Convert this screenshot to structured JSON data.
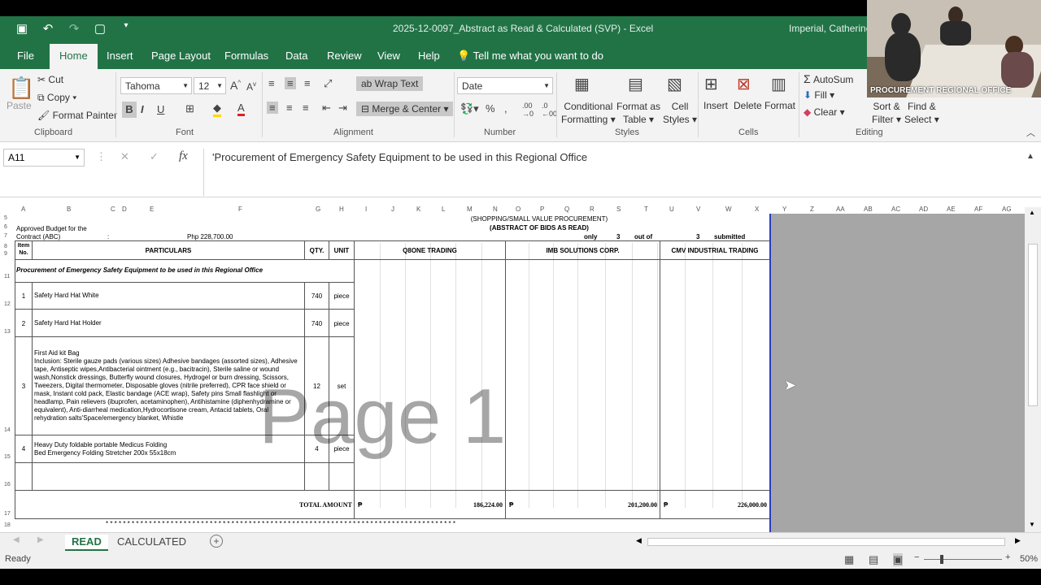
{
  "window": {
    "doc_title": "2025-12-0097_Abstract as Read & Calculated (SVP)  -  Excel",
    "user_name": "Imperial, Catherine"
  },
  "menu": {
    "tabs": [
      "File",
      "Home",
      "Insert",
      "Page Layout",
      "Formulas",
      "Data",
      "Review",
      "View",
      "Help"
    ],
    "tell_me": "Tell me what you want to do"
  },
  "ribbon": {
    "clipboard": {
      "paste": "Paste",
      "cut": "Cut",
      "copy": "Copy",
      "format_painter": "Format Painter",
      "label": "Clipboard"
    },
    "font": {
      "name": "Tahoma",
      "size": "12",
      "label": "Font",
      "bold": "B",
      "italic": "I",
      "underline": "U"
    },
    "alignment": {
      "wrap": "Wrap Text",
      "merge": "Merge & Center",
      "label": "Alignment"
    },
    "number": {
      "format": "Date",
      "label": "Number",
      "percent": "%"
    },
    "styles": {
      "conditional": "Conditional\nFormatting",
      "conditional_1": "Conditional",
      "conditional_2": "Formatting",
      "format_table_1": "Format as",
      "format_table_2": "Table",
      "cell_styles_1": "Cell",
      "cell_styles_2": "Styles",
      "label": "Styles"
    },
    "cells": {
      "insert": "Insert",
      "delete": "Delete",
      "format": "Format",
      "label": "Cells"
    },
    "editing": {
      "autosum": "AutoSum",
      "fill": "Fill",
      "clear": "Clear",
      "sort_1": "Sort &",
      "sort_2": "Filter",
      "find_1": "Find &",
      "find_2": "Select",
      "label": "Editing"
    }
  },
  "formula_bar": {
    "name_box": "A11",
    "fx": "fx",
    "content": "'Procurement of Emergency Safety Equipment to be used in this Regional Office"
  },
  "columns": [
    "A",
    "B",
    "C",
    "D",
    "E",
    "F",
    "G",
    "H",
    "I",
    "J",
    "K",
    "L",
    "M",
    "N",
    "O",
    "P",
    "Q",
    "R",
    "S",
    "T",
    "U",
    "V",
    "W",
    "X",
    "Y",
    "Z",
    "AA",
    "AB",
    "AC",
    "AD",
    "AE",
    "AF",
    "AG"
  ],
  "rows": [
    "5",
    "6",
    "7",
    "8",
    "9",
    "11",
    "12",
    "13",
    "14",
    "15",
    "16",
    "17",
    "18"
  ],
  "sheet": {
    "header_line": "(SHOPPING/SMALL VALUE PROCUREMENT)",
    "abstract_line": "(ABSTRACT OF BIDS AS READ)",
    "abc_label_1": "Approved Budget for the",
    "abc_label_2": "Contract (ABC)",
    "abc_colon": ":",
    "abc_value": "Php  228,700.00",
    "only": "only",
    "count_1": "3",
    "out_of": "out of",
    "count_2": "3",
    "submitted": "submitted",
    "col_item": "Item No.",
    "col_particulars": "PARTICULARS",
    "col_qty": "QTY.",
    "col_unit": "UNIT",
    "bidders": [
      "Q8ONE TRADING",
      "IMB SOLUTIONS CORP.",
      "CMV INDUSTRIAL TRADING"
    ],
    "project_title": "Procurement of Emergency Safety Equipment to be used in this Regional Office",
    "items": [
      {
        "no": "1",
        "desc": "Safety Hard Hat White",
        "qty": "740",
        "unit": "piece"
      },
      {
        "no": "2",
        "desc": "Safety Hard Hat Holder",
        "qty": "740",
        "unit": "piece"
      },
      {
        "no": "3",
        "desc_title": "First Aid kit Bag",
        "desc": "Inclusion: Sterile gauze pads (various sizes) Adhesive bandages (assorted sizes), Adhesive tape, Antiseptic wipes,Antibacterial ointment (e.g., bacitracin), Sterile saline or wound wash,Nonstick dressings, Butterfly wound closures, Hydrogel or burn dressing, Scissors, Tweezers, Digital thermometer, Disposable gloves (nitrile preferred), CPR face shield or mask, Instant cold pack, Elastic bandage (ACE wrap), Safety pins Small flashlight or headlamp, Pain relievers (ibuprofen, acetaminophen), Antihistamine (diphenhydramine or equivalent), Anti-diarrheal medication,Hydrocortisone cream, Antacid tablets, Oral rehydration salts'Space/emergency blanket, Whistle",
        "qty": "12",
        "unit": "set"
      },
      {
        "no": "4",
        "desc_title": "Heavy Duty foldable portable Medicus Folding",
        "desc": "Bed Emergency Folding Stretcher 200x 55x18cm",
        "qty": "4",
        "unit": "piece"
      }
    ],
    "total_label": "TOTAL AMOUNT",
    "peso": "₱",
    "totals": [
      "186,224.00",
      "201,200.00",
      "226,000.00"
    ],
    "stars": "* * * * * * * * * * * * * * * * * * * * * * * * * * * * * * * * * * * * * * * * * * * * * * * * * * * * * * * * * * * * * * * * * * * * * * * * * * * * * * * * *",
    "watermark": "Page 1"
  },
  "sheet_tabs": [
    "READ",
    "CALCULATED"
  ],
  "status": {
    "ready": "Ready",
    "zoom": "50%"
  },
  "video": {
    "caption": "PROCUREMENT REGIONAL OFFICE"
  }
}
